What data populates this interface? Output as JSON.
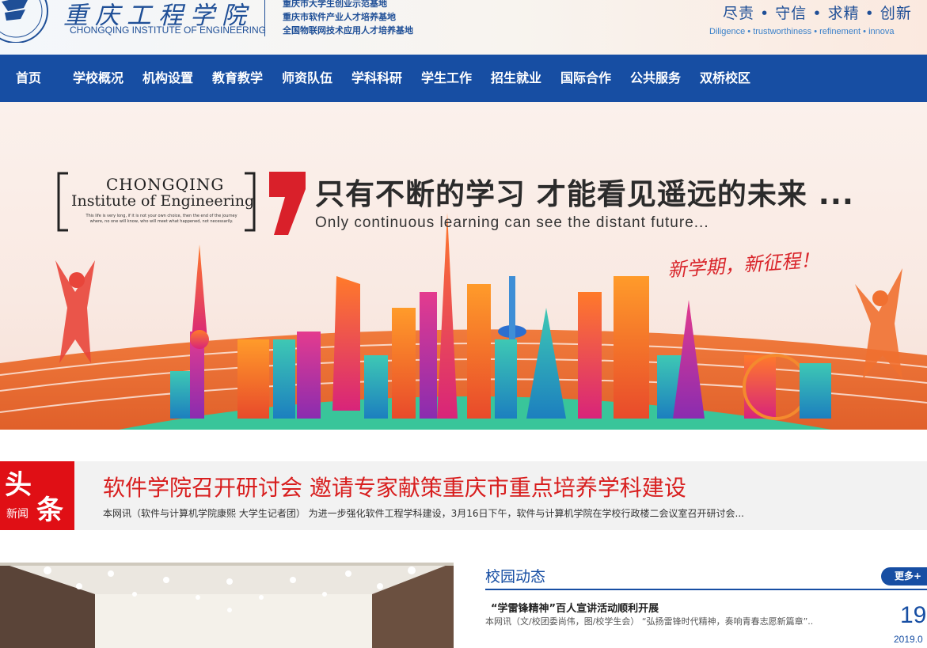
{
  "header": {
    "school_name_cn": "重庆工程学院",
    "school_name_en": "CHONGQING INSTITUTE OF ENGINEERING",
    "bases": [
      "重庆市大学生创业示范基地",
      "重庆市软件产业人才培养基地",
      "全国物联网技术应用人才培养基地"
    ],
    "motto_cn": "尽责 • 守信 • 求精  • 创新",
    "motto_en": "Diligence • trustworthiness • refinement • innova",
    "brand_color": "#174ea3"
  },
  "nav": {
    "items": [
      "首页",
      "学校概况",
      "机构设置",
      "教育教学",
      "师资队伍",
      "学科科研",
      "学生工作",
      "招生就业",
      "国际合作",
      "公共服务",
      "双桥校区"
    ]
  },
  "banner": {
    "brand_cq": "CHONGQING",
    "brand_inst": "Institute of Engineering",
    "brand_small": "This life is very long, if it is not your own choice, then the end of the journey where, no one will know, who will meet what happened, not necessarily.",
    "slogan_cn": "只有不断的学习  才能看见遥远的未来 ...",
    "slogan_en": "Only continuous learning can see the distant future...",
    "slogan_sub": "新学期，新征程！"
  },
  "headline": {
    "badge_top": "头",
    "badge_small": "新闻",
    "badge_bottom": "条",
    "title": "软件学院召开研讨会 邀请专家献策重庆市重点培养学科建设",
    "summary": "本网讯（软件与计算机学院康熙 大学生记者团） 为进一步强化软件工程学科建设，3月16日下午，软件与计算机学院在学校行政楼二会议室召开研讨会..."
  },
  "campus_news": {
    "section_title": "校园动态",
    "more_label": "更多+",
    "items": [
      {
        "title": "“学雷锋精神”百人宣讲活动顺利开展",
        "summary": "本网讯（文/校团委尚伟，图/校学生会） “弘扬雷锋时代精神，奏响青春志愿新篇章”..",
        "day": "19",
        "year_month": "2019.0"
      }
    ]
  }
}
